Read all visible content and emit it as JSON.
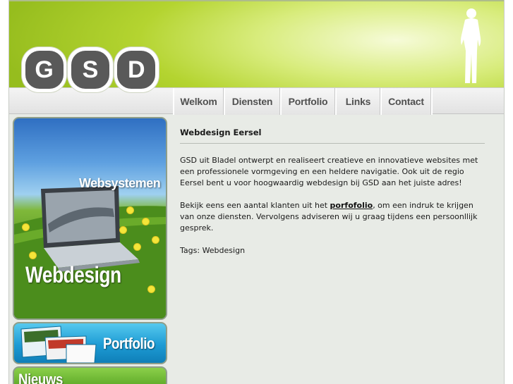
{
  "logo": {
    "letters": [
      "G",
      "S",
      "D"
    ]
  },
  "nav": {
    "items": [
      {
        "label": "Welkom"
      },
      {
        "label": "Diensten"
      },
      {
        "label": "Portfolio"
      },
      {
        "label": "Links"
      },
      {
        "label": "Contact"
      }
    ]
  },
  "sidebar": {
    "banner_web": {
      "small_label": "Websystemen",
      "big_label": "Webdesign"
    },
    "banner_portfolio": {
      "label": "Portfolio"
    },
    "banner_news": {
      "label": "Nieuws"
    }
  },
  "content": {
    "title": "Webdesign Eersel",
    "paragraph1": "GSD uit Bladel ontwerpt en realiseert creatieve en innovatieve websites met een professionele vormgeving en een heldere navigatie. Ook uit de regio Eersel bent u voor hoogwaardig webdesign bij GSD aan het juiste adres!",
    "paragraph2_before": "Bekijk eens een aantal klanten uit het ",
    "paragraph2_link": "porfofolio",
    "paragraph2_after": ", om een indruk te krijgen van onze diensten. Vervolgens adviseren wij u graag tijdens een persoonllijk gesprek.",
    "tags_label": "Tags:",
    "tags_value": "Webdesign"
  },
  "colors": {
    "header_green": "#b4d430",
    "frame_bg": "#e8ebe6",
    "nav_text": "#505050",
    "logo_gray": "#595959"
  }
}
